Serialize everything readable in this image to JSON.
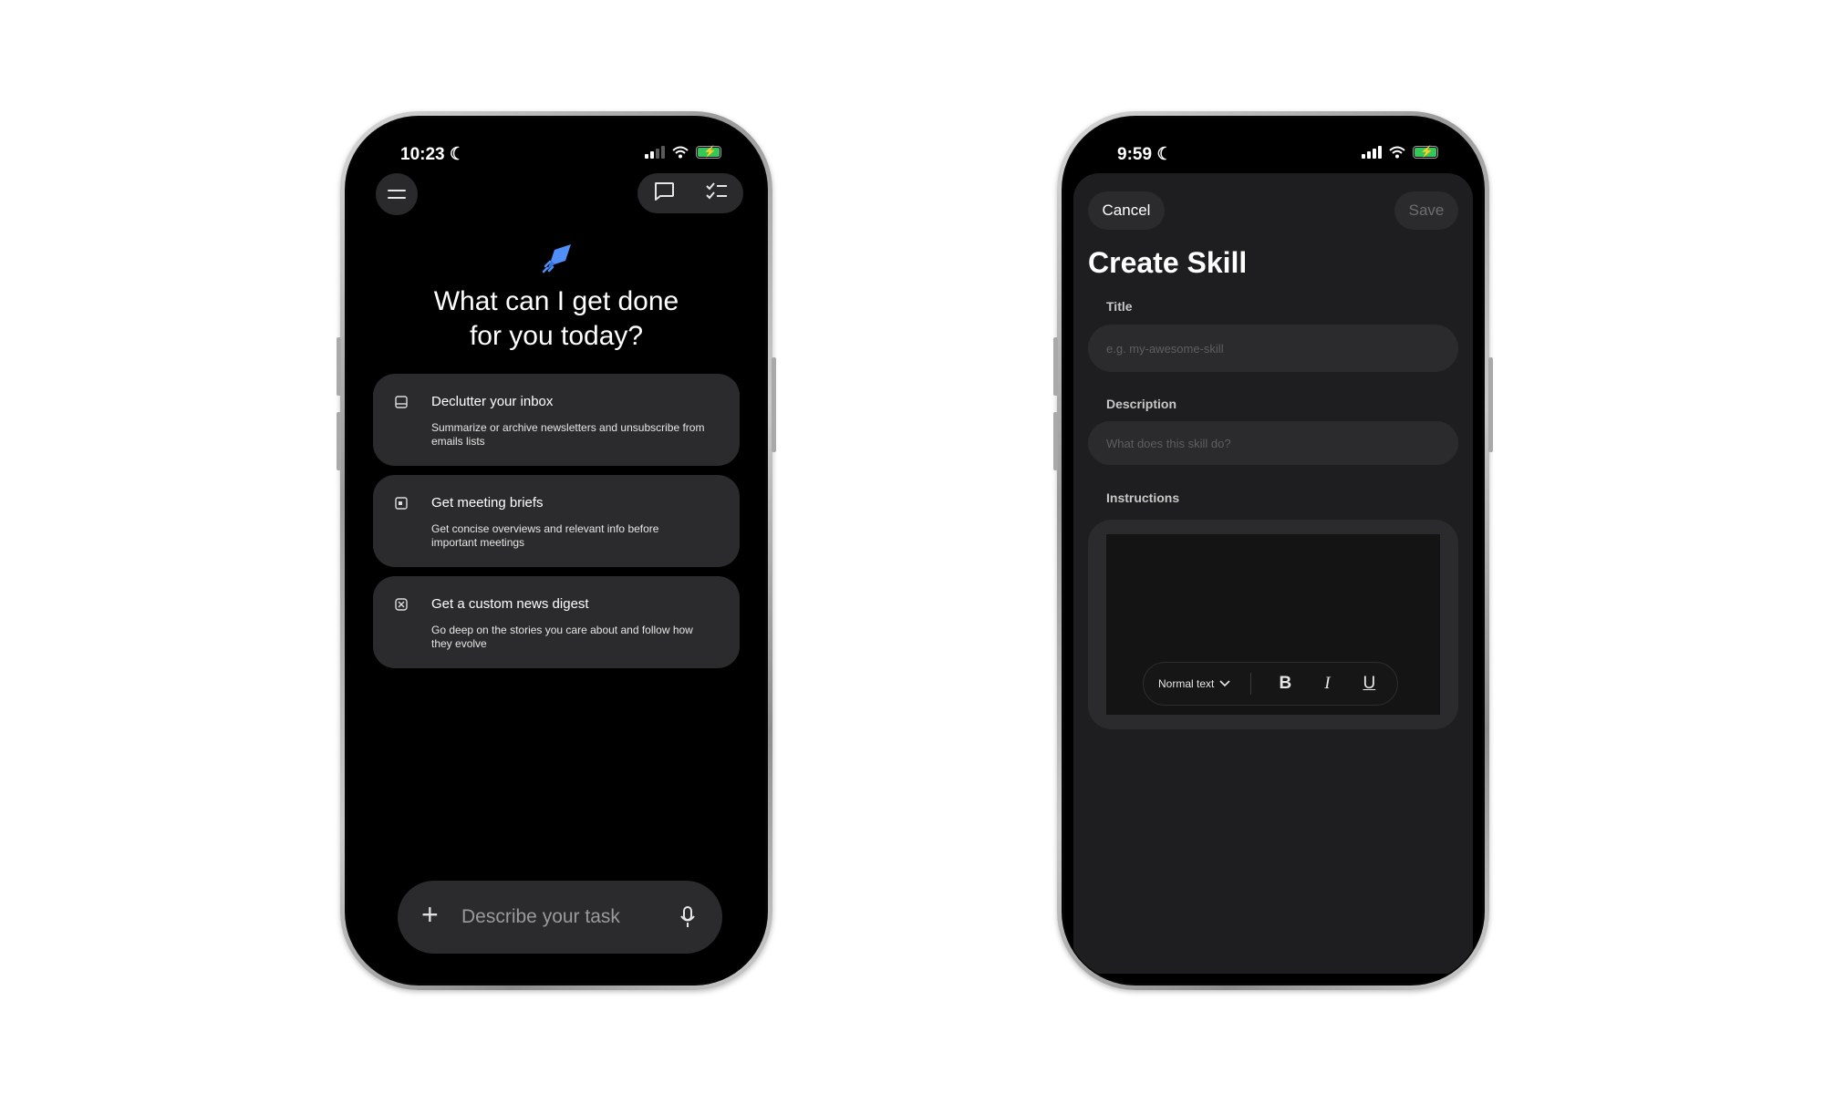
{
  "left_phone": {
    "status": {
      "time": "10:23"
    },
    "header": {
      "menu_icon": "hamburger-menu-icon",
      "chat_icon": "chat-bubble-icon",
      "tasks_icon": "checklist-icon"
    },
    "hero": {
      "icon": "rocket-icon",
      "accent": "#4f8ff7",
      "headline_line1": "What can I get done",
      "headline_line2": "for you today?"
    },
    "suggestions": [
      {
        "icon": "inbox-icon",
        "title": "Declutter your inbox",
        "description": "Summarize or archive newsletters and unsubscribe from emails lists"
      },
      {
        "icon": "calendar-icon",
        "title": "Get meeting briefs",
        "description": "Get concise overviews and relevant info before important meetings"
      },
      {
        "icon": "news-icon",
        "title": "Get a custom news digest",
        "description": "Go deep on the stories you care about and follow how they evolve"
      }
    ],
    "input": {
      "placeholder": "Describe your task",
      "value": ""
    }
  },
  "right_phone": {
    "status": {
      "time": "9:59"
    },
    "cancel_label": "Cancel",
    "save_label": "Save",
    "title": "Create Skill",
    "fields": {
      "title_label": "Title",
      "title_placeholder": "e.g. my-awesome-skill",
      "description_label": "Description",
      "description_placeholder": "What does this skill do?",
      "instructions_label": "Instructions"
    },
    "toolbar": {
      "style_select": "Normal text",
      "bold": "B",
      "italic": "I",
      "underline": "U"
    }
  },
  "colors": {
    "background": "#ffffff",
    "screen": "#000000",
    "card": "#2b2b2d",
    "battery": "#34c759"
  }
}
